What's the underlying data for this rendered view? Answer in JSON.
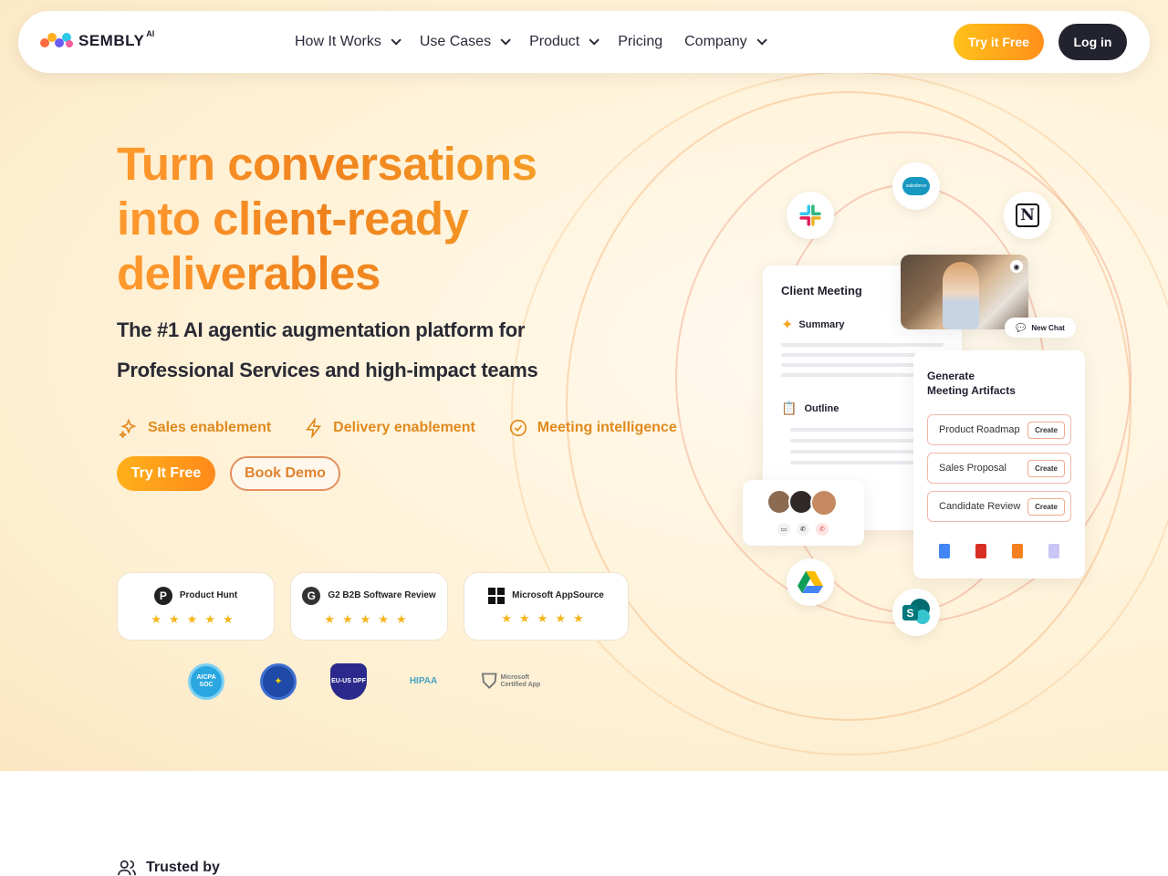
{
  "nav": {
    "brand": "SEMBLY",
    "brand_suffix": "AI",
    "links": [
      {
        "label": "How It Works",
        "has_dropdown": true
      },
      {
        "label": "Use Cases",
        "has_dropdown": true
      },
      {
        "label": "Product",
        "has_dropdown": true
      },
      {
        "label": "Pricing",
        "has_dropdown": false
      },
      {
        "label": "Company",
        "has_dropdown": true
      }
    ],
    "try_free": "Try it Free",
    "login": "Log in"
  },
  "hero": {
    "headline": [
      "Turn conversations",
      "into client-ready",
      "deliverables"
    ],
    "subtitle_line1": "The #1 AI agentic augmentation platform for",
    "subtitle_line2": "Professional Services and high-impact teams",
    "features": [
      {
        "icon": "sparkles-icon",
        "label": "Sales enablement"
      },
      {
        "icon": "bolt-icon",
        "label": "Delivery enablement"
      },
      {
        "icon": "check-circle-icon",
        "label": "Meeting intelligence"
      }
    ],
    "cta_primary": "Try It Free",
    "cta_secondary": "Book Demo"
  },
  "reviews": [
    {
      "name": "Product Hunt",
      "logo": "P",
      "stars": "★★★★★"
    },
    {
      "name": "G2 B2B Software Review",
      "logo": "G",
      "stars": "★★★★★"
    },
    {
      "name": "Microsoft AppSource",
      "logo": "ms",
      "stars": "★★★★★"
    }
  ],
  "compliance": [
    {
      "name": "aicpa-soc-badge",
      "label": "AICPA SOC"
    },
    {
      "name": "gdpr-eu-badge",
      "label": ""
    },
    {
      "name": "eu-us-dpf-badge",
      "label": "EU-US DPF"
    },
    {
      "name": "hipaa-badge",
      "label": "HIPAA"
    },
    {
      "name": "microsoft-certified-badge",
      "label": "Microsoft Certified App"
    }
  ],
  "illustration": {
    "meeting_card_title": "Client Meeting",
    "summary_label": "Summary",
    "outline_label": "Outline",
    "new_chat": "New Chat",
    "artifacts_title_line1": "Generate",
    "artifacts_title_line2": "Meeting Artifacts",
    "artifacts": [
      {
        "label": "Product Roadmap",
        "action": "Create"
      },
      {
        "label": "Sales Proposal",
        "action": "Create"
      },
      {
        "label": "Candidate Review",
        "action": "Create"
      }
    ],
    "integrations": [
      "slack-icon",
      "salesforce-icon",
      "notion-icon",
      "google-drive-icon",
      "sharepoint-icon"
    ],
    "salesforce_text": "salesforce",
    "notion_text": "N",
    "sharepoint_text": "S"
  },
  "trusted_by": "Trusted by",
  "colors": {
    "accent_orange": "#ff9a2e",
    "dark_button": "#23232f",
    "star": "#f5b51a"
  }
}
